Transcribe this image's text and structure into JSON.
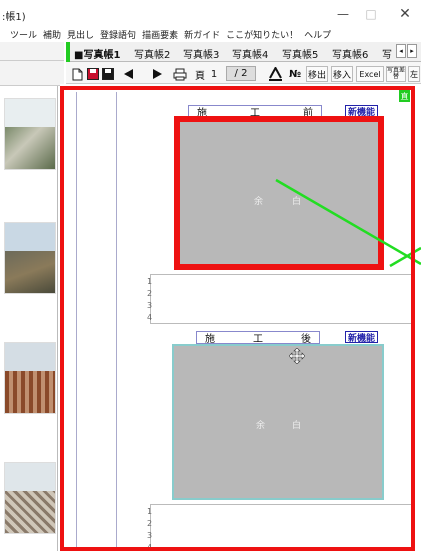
{
  "window": {
    "title": ":帳1)",
    "btn_minimize": "—",
    "btn_maximize": "□",
    "btn_close": "✕"
  },
  "menu": [
    "ツール",
    "補助",
    "見出し",
    "登録語句",
    "描画要素",
    "新ガイド",
    "ここが知りたい！",
    "ヘルプ"
  ],
  "tabs": [
    "■写真帳1",
    "写真帳2",
    "写真帳3",
    "写真帳4",
    "写真帳5",
    "写真帳6",
    "写"
  ],
  "tab_scroll": {
    "left": "◂",
    "right": "▸"
  },
  "toolbar": {
    "page_label": "頁",
    "page_current": "1",
    "page_sep": "/",
    "page_total": "2",
    "btn_no": "№",
    "btn_extract": "移出",
    "btn_import": "移入",
    "btn_excel": "Excel",
    "btn_photo_replace": "写真差替",
    "btn_more": "左"
  },
  "page": {
    "corner_badge": "直",
    "photo1": {
      "caption": [
        "施",
        "工",
        "前"
      ],
      "badge": "新機能",
      "center": [
        "余",
        "白"
      ],
      "memo_lines": [
        "1",
        "2",
        "3",
        "4"
      ]
    },
    "photo2": {
      "caption": [
        "施",
        "工",
        "後"
      ],
      "badge": "新機能",
      "center": [
        "余",
        "白"
      ],
      "memo_lines": [
        "1",
        "2",
        "3",
        "4"
      ]
    }
  },
  "colors": {
    "highlight_red": "#ee1111",
    "pointer_green": "#22dd22",
    "badge_blue": "#2222aa",
    "tab_indicator": "#22cc22"
  }
}
